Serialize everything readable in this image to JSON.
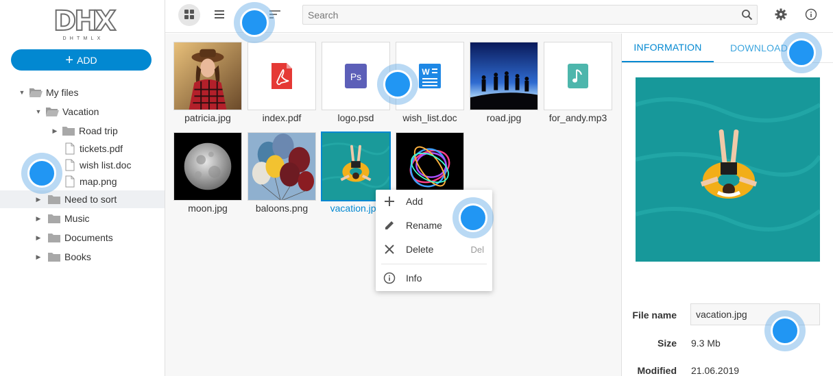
{
  "app": {
    "logo_text": "DHX",
    "logo_subtext": "DHTMLX",
    "add_label": "ADD"
  },
  "tree": [
    {
      "label": "My files",
      "level": 0,
      "type": "folder",
      "state": "open"
    },
    {
      "label": "Vacation",
      "level": 1,
      "type": "folder",
      "state": "open"
    },
    {
      "label": "Road trip",
      "level": 2,
      "type": "folder",
      "state": "closed"
    },
    {
      "label": "tickets.pdf",
      "level": 2,
      "type": "file"
    },
    {
      "label": "wish list.doc",
      "level": 2,
      "type": "file"
    },
    {
      "label": "map.png",
      "level": 2,
      "type": "file"
    },
    {
      "label": "Need to sort",
      "level": 1,
      "type": "folder",
      "state": "closed",
      "selected": true
    },
    {
      "label": "Music",
      "level": 1,
      "type": "folder",
      "state": "closed"
    },
    {
      "label": "Documents",
      "level": 1,
      "type": "folder",
      "state": "closed"
    },
    {
      "label": "Books",
      "level": 1,
      "type": "folder",
      "state": "closed"
    }
  ],
  "toolbar": {
    "search_placeholder": "Search",
    "grid_view_icon": "grid-view-icon",
    "list_view_icon": "list-view-icon",
    "sort_icon": "sort-icon",
    "settings_icon": "gear-icon",
    "info_icon": "info-icon"
  },
  "files": [
    {
      "name": "patricia.jpg",
      "kind": "photo-portrait"
    },
    {
      "name": "index.pdf",
      "kind": "pdf-icon"
    },
    {
      "name": "logo.psd",
      "kind": "psd-icon"
    },
    {
      "name": "wish_list.doc",
      "kind": "doc-icon"
    },
    {
      "name": "road.jpg",
      "kind": "photo-silhouettes"
    },
    {
      "name": "for_andy.mp3",
      "kind": "audio-icon"
    },
    {
      "name": "moon.jpg",
      "kind": "photo-moon"
    },
    {
      "name": "baloons.png",
      "kind": "photo-balloons"
    },
    {
      "name": "vacation.jpg",
      "kind": "photo-pool",
      "selected": true
    },
    {
      "name": "",
      "kind": "photo-lights"
    }
  ],
  "context_menu": {
    "items": [
      {
        "label": "Add",
        "icon": "plus-icon",
        "hotkey": ""
      },
      {
        "label": "Rename",
        "icon": "pencil-icon",
        "hotkey": ""
      },
      {
        "label": "Delete",
        "icon": "close-icon",
        "hotkey": "Del"
      },
      {
        "label": "Info",
        "icon": "info-icon",
        "hotkey": ""
      }
    ]
  },
  "details": {
    "tabs": [
      "INFORMATION",
      "DOWNLOAD"
    ],
    "active_tab": "INFORMATION",
    "file_name_label": "File name",
    "file_name_value": "vacation.jpg",
    "size_label": "Size",
    "size_value": "9.3 Mb",
    "modified_label": "Modified",
    "modified_value": "21.06.2019"
  },
  "colors": {
    "accent": "#0288d1",
    "selected_row": "#eef0f3",
    "grid_bg": "#f7f7f7",
    "pool": "#1a9a9a"
  }
}
